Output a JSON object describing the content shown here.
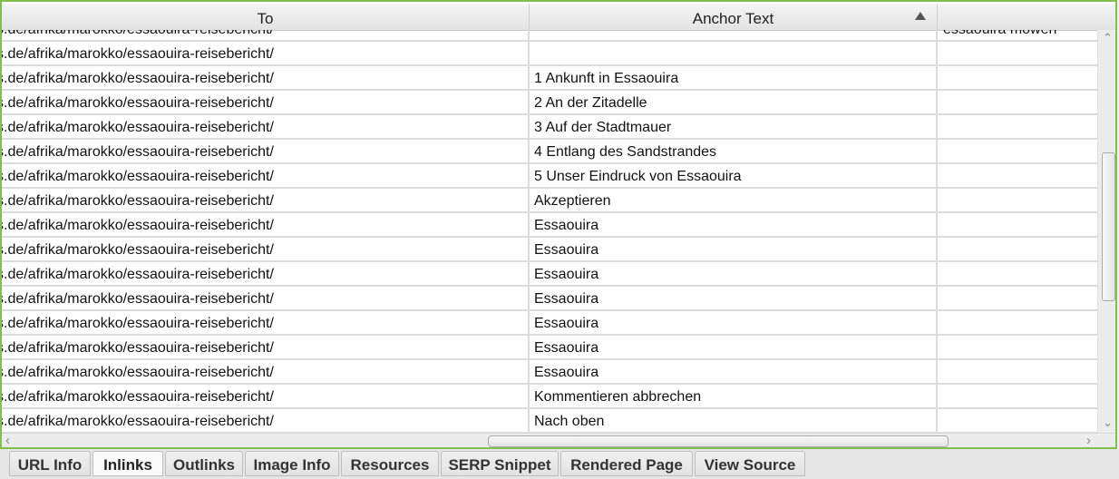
{
  "table": {
    "columns": [
      {
        "label": "To"
      },
      {
        "label": "Anchor Text",
        "sort": "ascending"
      },
      {
        "label": ""
      }
    ],
    "partial_top_row": {
      "to": "s.de/afrika/marokko/essaouira-reisebericht/",
      "anchor": "",
      "extra": "essaouira möwen"
    },
    "rows": [
      {
        "to": "s.de/afrika/marokko/essaouira-reisebericht/",
        "anchor": "",
        "extra": ""
      },
      {
        "to": "s.de/afrika/marokko/essaouira-reisebericht/",
        "anchor": "1 Ankunft in Essaouira",
        "extra": ""
      },
      {
        "to": "s.de/afrika/marokko/essaouira-reisebericht/",
        "anchor": "2 An der Zitadelle",
        "extra": ""
      },
      {
        "to": "s.de/afrika/marokko/essaouira-reisebericht/",
        "anchor": "3 Auf der Stadtmauer",
        "extra": ""
      },
      {
        "to": "s.de/afrika/marokko/essaouira-reisebericht/",
        "anchor": "4 Entlang des Sandstrandes",
        "extra": ""
      },
      {
        "to": "s.de/afrika/marokko/essaouira-reisebericht/",
        "anchor": "5 Unser Eindruck von Essaouira",
        "extra": ""
      },
      {
        "to": "s.de/afrika/marokko/essaouira-reisebericht/",
        "anchor": "Akzeptieren",
        "extra": ""
      },
      {
        "to": "s.de/afrika/marokko/essaouira-reisebericht/",
        "anchor": "Essaouira",
        "extra": ""
      },
      {
        "to": "s.de/afrika/marokko/essaouira-reisebericht/",
        "anchor": "Essaouira",
        "extra": ""
      },
      {
        "to": "s.de/afrika/marokko/essaouira-reisebericht/",
        "anchor": "Essaouira",
        "extra": ""
      },
      {
        "to": "s.de/afrika/marokko/essaouira-reisebericht/",
        "anchor": "Essaouira",
        "extra": ""
      },
      {
        "to": "s.de/afrika/marokko/essaouira-reisebericht/",
        "anchor": "Essaouira",
        "extra": ""
      },
      {
        "to": "s.de/afrika/marokko/essaouira-reisebericht/",
        "anchor": "Essaouira",
        "extra": ""
      },
      {
        "to": "s.de/afrika/marokko/essaouira-reisebericht/",
        "anchor": "Essaouira",
        "extra": ""
      },
      {
        "to": "s.de/afrika/marokko/essaouira-reisebericht/",
        "anchor": "Kommentieren abbrechen",
        "extra": ""
      },
      {
        "to": "s.de/afrika/marokko/essaouira-reisebericht/",
        "anchor": "Nach oben",
        "extra": ""
      }
    ]
  },
  "scrollbars": {
    "vertical_icons": {
      "up": "chevron-up-icon",
      "down": "chevron-down-icon"
    },
    "horizontal_icons": {
      "left": "chevron-left-icon",
      "right": "chevron-right-icon"
    }
  },
  "tabs": [
    {
      "label": "URL Info",
      "active": false
    },
    {
      "label": "Inlinks",
      "active": true
    },
    {
      "label": "Outlinks",
      "active": false
    },
    {
      "label": "Image Info",
      "active": false
    },
    {
      "label": "Resources",
      "active": false
    },
    {
      "label": "SERP Snippet",
      "active": false
    },
    {
      "label": "Rendered Page",
      "active": false
    },
    {
      "label": "View Source",
      "active": false
    }
  ],
  "colors": {
    "frame_border": "#7ec24a",
    "grid_line": "#dcdcdc"
  }
}
